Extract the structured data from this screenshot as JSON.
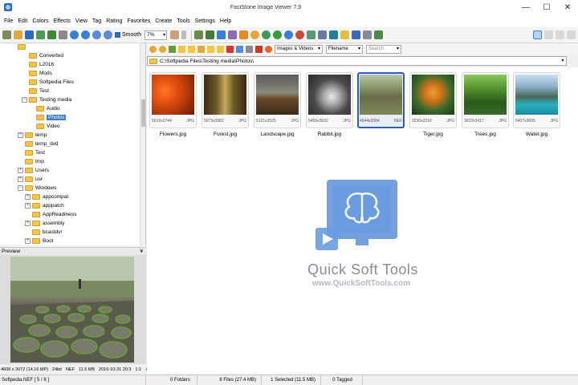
{
  "window": {
    "title": "FastStone Image Viewer 7.9"
  },
  "menu": [
    "File",
    "Edit",
    "Colors",
    "Effects",
    "View",
    "Tag",
    "Rating",
    "Favorites",
    "Create",
    "Tools",
    "Settings",
    "Help"
  ],
  "toolbar": {
    "smooth_label": "Smooth",
    "zoom_value": "7%"
  },
  "tree": {
    "items": [
      {
        "label": "Converted"
      },
      {
        "label": "L2016"
      },
      {
        "label": "Mods"
      },
      {
        "label": "Softpedia Files"
      },
      {
        "label": "Test"
      },
      {
        "label": "Testing media"
      },
      {
        "label": "Audio"
      },
      {
        "label": "Photos"
      },
      {
        "label": "Video"
      },
      {
        "label": "temp"
      },
      {
        "label": "temp_dvd"
      },
      {
        "label": "Test"
      },
      {
        "label": "tmp"
      },
      {
        "label": "Users"
      },
      {
        "label": "usr"
      },
      {
        "label": "Windows"
      },
      {
        "label": "appcompat"
      },
      {
        "label": "apppatch"
      },
      {
        "label": "AppReadiness"
      },
      {
        "label": "assembly"
      },
      {
        "label": "bcastdvr"
      },
      {
        "label": "Boot"
      }
    ]
  },
  "preview": {
    "header": "Preview",
    "info": [
      "4608 x 3072 (14.16 MP)",
      "24bit",
      "NEF",
      "11.5 MB",
      "2016-10-31 20:3",
      "1:1"
    ]
  },
  "navbar": {
    "filter": "Images & Videos",
    "sort": "Filename",
    "search_placeholder": "Search"
  },
  "path": "C:\\Softpedia Files\\Testing media\\Photos\\",
  "thumbnails": [
    {
      "name": "Flowers.jpg",
      "dims": "5616x3744",
      "type": "JPG"
    },
    {
      "name": "Forest.jpg",
      "dims": "5073x3382",
      "type": "JPG"
    },
    {
      "name": "Landscape.jpg",
      "dims": "5121x3525",
      "type": "JPG"
    },
    {
      "name": "Rabbit.jpg",
      "dims": "5456x3632",
      "type": "JPG"
    },
    {
      "name": "",
      "dims": "4644x2084",
      "type": "NEF"
    },
    {
      "name": "Tiger.jpg",
      "dims": "3230x2216",
      "type": "JPG"
    },
    {
      "name": "Trees.jpg",
      "dims": "3632x2417",
      "type": "JPG"
    },
    {
      "name": "Water.jpg",
      "dims": "5407x3605",
      "type": "JPG"
    }
  ],
  "watermark": {
    "title": "Quick Soft Tools",
    "url": "www.QuickSoftTools.com"
  },
  "status": {
    "file": "Softpedia.NEF [ 5 / 8 ]",
    "folders": "0 Folders",
    "files": "8 Files (27.4 MB)",
    "selected": "1 Selected (11.5 MB)",
    "tagged": "0 Tagged"
  },
  "colors": {
    "accent": "#2b5fb5",
    "folder": "#f3c34b",
    "selection": "#3a7fd6"
  }
}
